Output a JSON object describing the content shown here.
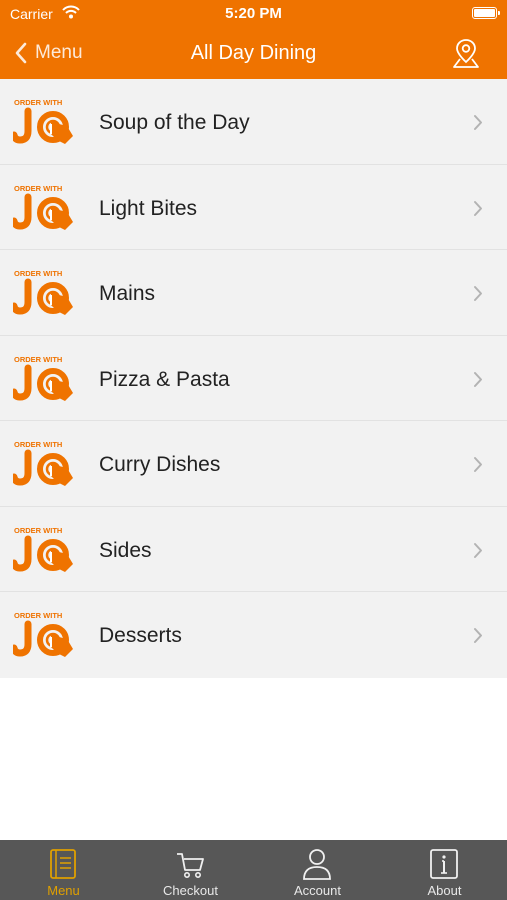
{
  "status": {
    "carrier": "Carrier",
    "time": "5:20 PM"
  },
  "nav": {
    "back_label": "Menu",
    "title": "All Day Dining"
  },
  "logo": {
    "line1": "ORDER WITH",
    "line2": "JO"
  },
  "categories": [
    {
      "label": "Soup of the Day"
    },
    {
      "label": "Light Bites"
    },
    {
      "label": "Mains"
    },
    {
      "label": "Pizza & Pasta"
    },
    {
      "label": "Curry Dishes"
    },
    {
      "label": "Sides"
    },
    {
      "label": "Desserts"
    }
  ],
  "tabs": [
    {
      "label": "Menu",
      "icon": "menu-book-icon",
      "active": true
    },
    {
      "label": "Checkout",
      "icon": "cart-icon",
      "active": false
    },
    {
      "label": "Account",
      "icon": "person-icon",
      "active": false
    },
    {
      "label": "About",
      "icon": "info-icon",
      "active": false
    }
  ],
  "colors": {
    "accent": "#ef7300",
    "tabbar": "#575757",
    "tab_active": "#e0a000",
    "list_bg": "#f2f2f2"
  }
}
